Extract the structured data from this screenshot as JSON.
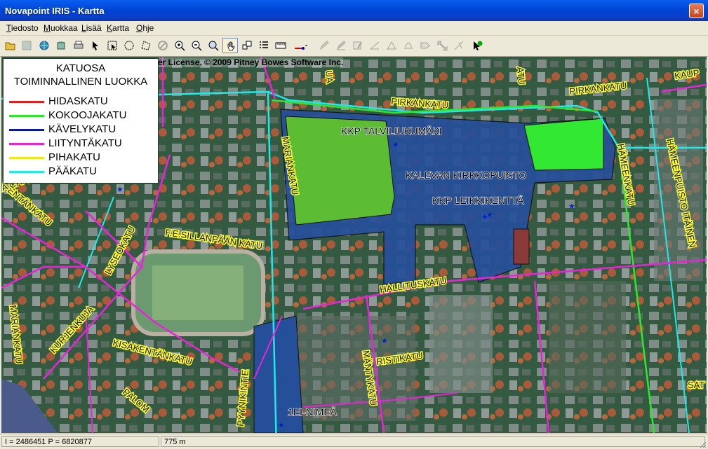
{
  "window": {
    "title": "Novapoint IRIS - Kartta",
    "close_label": "×"
  },
  "menu": [
    "Tiedosto",
    "Muokkaa",
    "Lisää",
    "Kartta",
    "Ohje"
  ],
  "toolbar": {
    "icons": [
      "open-folder-icon",
      "save-icon",
      "globe-icon",
      "database-icon",
      "print-icon",
      "select-arrow-icon",
      "select-box-icon",
      "select-circle-icon",
      "select-polygon-icon",
      "cancel-icon",
      "zoom-in-icon",
      "zoom-out-icon",
      "zoom-box-icon",
      "pan-hand-icon",
      "layers-icon",
      "list-icon",
      "ruler-icon",
      "line-tool-icon",
      "pencil-icon",
      "edit-icon",
      "edit-table-icon",
      "split-icon",
      "merge-icon",
      "reshape-icon",
      "tag-icon",
      "move-icon",
      "snap-icon",
      "info-icon"
    ]
  },
  "legend": {
    "title_line1": "KATUOSA",
    "title_line2": "TOIMINNALLINEN LUOKKA",
    "items": [
      {
        "label": "HIDASKATU",
        "color": "#e0201c"
      },
      {
        "label": "KOKOOJAKATU",
        "color": "#2ee82e"
      },
      {
        "label": "KÄVELYKATU",
        "color": "#0a1a9a"
      },
      {
        "label": "LIITYNTÄKATU",
        "color": "#e824d8"
      },
      {
        "label": "PIHAKATU",
        "color": "#f0e81a"
      },
      {
        "label": "PÄÄKATU",
        "color": "#22e8e8"
      }
    ]
  },
  "map": {
    "copyright": "er License, © 2009 Pitney Bowes Software Inc.",
    "areas": [
      "KKP TALVILIUKUMÄKI",
      "KALEVAN KIRKKOPUISTO",
      "KKP LEIKKIKENTTÄ",
      "1EI-NIMEÄ"
    ],
    "streets": [
      "PIRKANKATU",
      "PIRKANKATU",
      "MARIANKATU",
      "HÄMEENKATU",
      "HÄMEENPUISTO ITÄINEN",
      "F.E.SILLANPÄÄN KATU",
      "LYSEOKATU",
      "HALLITUSKATU",
      "KISAKENTÄNKATU",
      "KURJENKUJA",
      "MARIANKATU",
      "RISTIKATU",
      "MÄNTYKATU",
      "PYYNIKINTIE",
      "PALOM",
      "KAUP",
      "SAT",
      "ENTÄNKATU",
      "A CAN",
      "UA",
      "ATU"
    ]
  },
  "status": {
    "coords": "I = 2486451  P = 6820877",
    "scale": "775 m"
  }
}
